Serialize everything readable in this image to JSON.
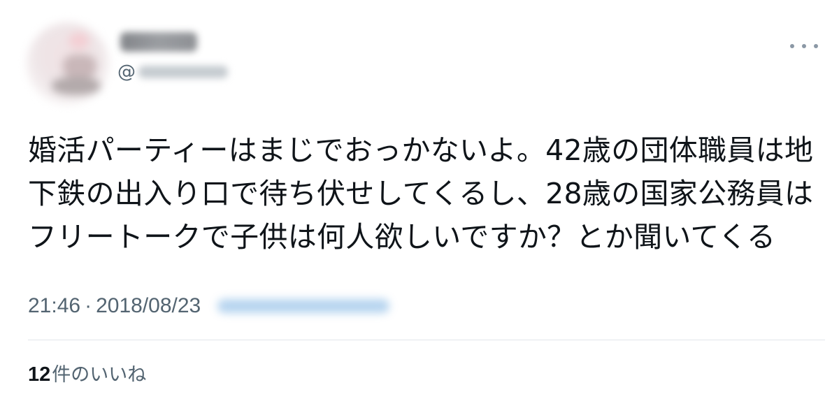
{
  "tweet": {
    "handle_prefix": "@",
    "text_lines": [
      "婚活パーティーはまじでおっかないよ。42歳の団体職員は地",
      "下鉄の出入り口で待ち伏せしてくるし、28歳の国家公務員は",
      "フリートークで子供は何人欲しいですか？とか聞いてくる"
    ],
    "time": "21:46",
    "separator": "·",
    "date": "2018/08/23",
    "likes_count": "12",
    "likes_label": "件のいいね"
  },
  "icons": {
    "more": "more-horizontal-icon"
  },
  "colors": {
    "text_primary": "#0f1419",
    "text_secondary": "#536471",
    "divider": "#e1e6ea"
  }
}
